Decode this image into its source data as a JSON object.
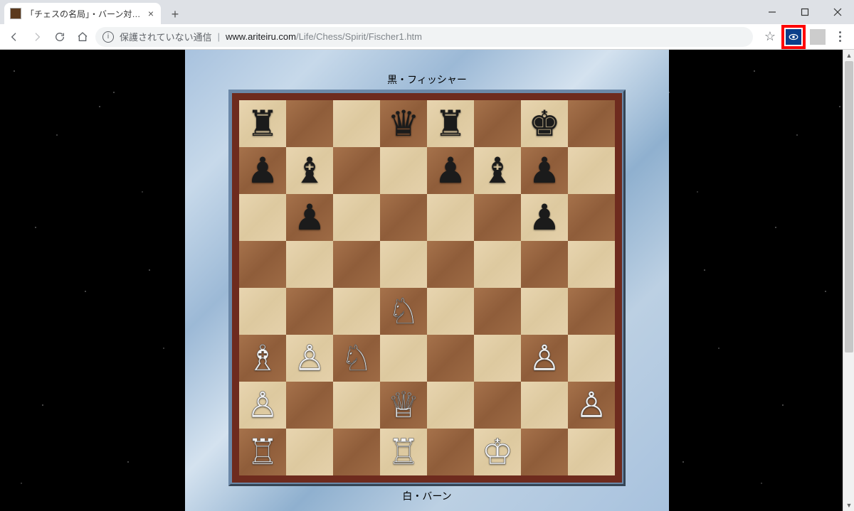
{
  "browser": {
    "tab_title": "「チェスの名局」・バーン対フィッシャー",
    "security_text": "保護されていない通信",
    "url_host": "www.ariteiru.com",
    "url_path": "/Life/Chess/Spirit/Fischer1.htm",
    "highlight_extension": true
  },
  "page": {
    "top_label": "黒・フィッシャー",
    "bottom_label": "白・バーン"
  },
  "board": {
    "light_color": "#e8d5b0",
    "dark_color": "#a6724b",
    "frame_color": "#6e2b1e",
    "rows": [
      [
        {
          "p": "r",
          "c": "b"
        },
        null,
        null,
        {
          "p": "q",
          "c": "b"
        },
        {
          "p": "r",
          "c": "b"
        },
        null,
        {
          "p": "k",
          "c": "b"
        },
        null
      ],
      [
        {
          "p": "p",
          "c": "b"
        },
        {
          "p": "b",
          "c": "b"
        },
        null,
        null,
        {
          "p": "p",
          "c": "b"
        },
        {
          "p": "b",
          "c": "b"
        },
        {
          "p": "p",
          "c": "b"
        },
        null
      ],
      [
        null,
        {
          "p": "p",
          "c": "b"
        },
        null,
        null,
        null,
        null,
        {
          "p": "p",
          "c": "b"
        },
        null
      ],
      [
        null,
        null,
        null,
        null,
        null,
        null,
        null,
        null
      ],
      [
        null,
        null,
        null,
        {
          "p": "n",
          "c": "w"
        },
        null,
        null,
        null,
        null
      ],
      [
        {
          "p": "b",
          "c": "w"
        },
        {
          "p": "p",
          "c": "w"
        },
        {
          "p": "n",
          "c": "w"
        },
        null,
        null,
        null,
        {
          "p": "p",
          "c": "w"
        },
        null
      ],
      [
        {
          "p": "p",
          "c": "w"
        },
        null,
        null,
        {
          "p": "q",
          "c": "w"
        },
        null,
        null,
        null,
        {
          "p": "p",
          "c": "w"
        }
      ],
      [
        {
          "p": "r",
          "c": "w"
        },
        null,
        null,
        {
          "p": "r",
          "c": "w"
        },
        null,
        {
          "p": "k",
          "c": "w"
        },
        null,
        null
      ]
    ]
  },
  "glyphs": {
    "k_b": "♚",
    "q_b": "♛",
    "r_b": "♜",
    "b_b": "♝",
    "n_b": "♞",
    "p_b": "♟",
    "k_w": "♔",
    "q_w": "♕",
    "r_w": "♖",
    "b_w": "♗",
    "n_w": "♘",
    "p_w": "♙"
  }
}
